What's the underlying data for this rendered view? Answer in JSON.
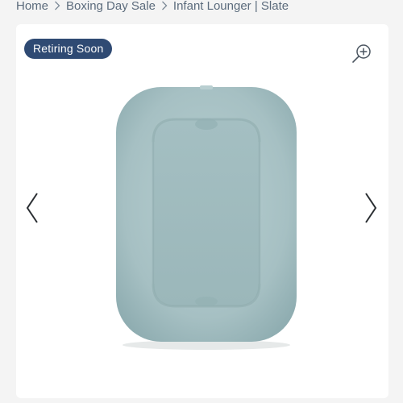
{
  "breadcrumb": {
    "items": [
      {
        "label": "Home"
      },
      {
        "label": "Boxing Day Sale"
      },
      {
        "label": "Infant Lounger | Slate"
      }
    ],
    "separator_icon": "chevron-right-icon"
  },
  "gallery": {
    "badge": "Retiring Soon",
    "zoom_icon": "zoom-in-icon",
    "prev_icon": "chevron-left-icon",
    "next_icon": "chevron-right-icon",
    "product_image_alt": "Infant Lounger | Slate"
  },
  "colors": {
    "badge_bg": "#2f4a73",
    "breadcrumb_text": "#5b6b7c",
    "lounger": "#a9c3c6",
    "page_bg": "#f4f4f4"
  }
}
